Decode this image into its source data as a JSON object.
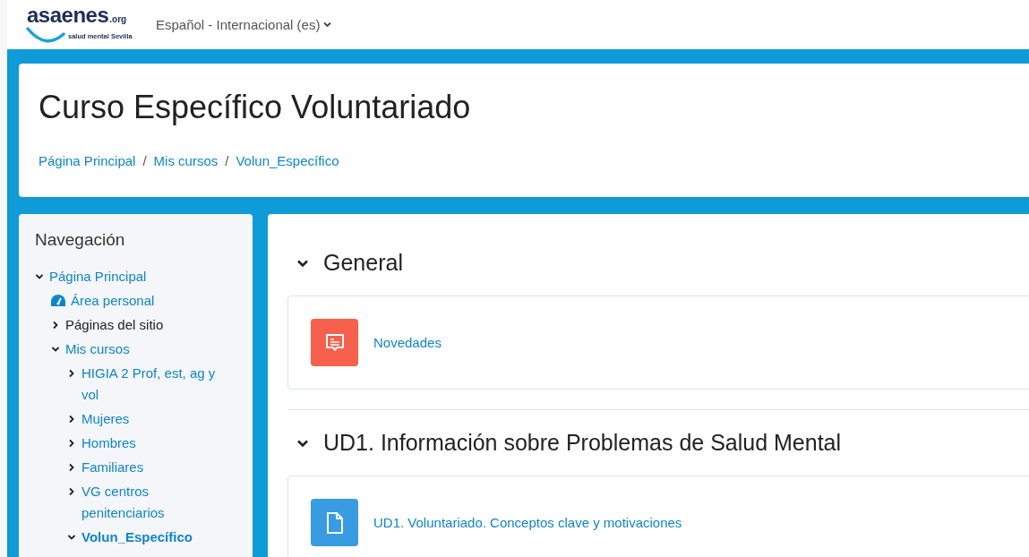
{
  "navbar": {
    "logo": {
      "name": "asaenes",
      "suffix": ".org",
      "tagline": "salud mental Sevilla"
    },
    "language": "Español - Internacional (es)"
  },
  "header": {
    "title": "Curso Específico Voluntariado",
    "breadcrumb": [
      "Página Principal",
      "Mis cursos",
      "Volun_Específico"
    ],
    "separator": "/"
  },
  "sidebar": {
    "title": "Navegación",
    "items": [
      {
        "label": "Página Principal",
        "kind": "branch",
        "expanded": true,
        "link": true,
        "selected": false,
        "children": [
          {
            "label": "Área personal",
            "kind": "dashboard",
            "expanded": false,
            "link": true,
            "selected": false
          },
          {
            "label": "Páginas del sitio",
            "kind": "branch",
            "expanded": false,
            "link": false,
            "selected": false
          },
          {
            "label": "Mis cursos",
            "kind": "branch",
            "expanded": true,
            "link": true,
            "selected": false,
            "children": [
              {
                "label": "HIGIA 2 Prof, est, ag y vol",
                "kind": "branch",
                "expanded": false,
                "link": true,
                "selected": false
              },
              {
                "label": "Mujeres",
                "kind": "branch",
                "expanded": false,
                "link": true,
                "selected": false
              },
              {
                "label": "Hombres",
                "kind": "branch",
                "expanded": false,
                "link": true,
                "selected": false
              },
              {
                "label": "Familiares",
                "kind": "branch",
                "expanded": false,
                "link": true,
                "selected": false
              },
              {
                "label": "VG centros penitenciarios",
                "kind": "branch",
                "expanded": false,
                "link": true,
                "selected": false
              },
              {
                "label": "Volun_Específico",
                "kind": "branch",
                "expanded": true,
                "link": true,
                "selected": true
              }
            ]
          }
        ]
      }
    ]
  },
  "sections": [
    {
      "title": "General",
      "expanded": true,
      "activities": [
        {
          "label": "Novedades",
          "kind": "forum",
          "color": "#f7604d"
        }
      ]
    },
    {
      "title": "UD1. Información sobre Problemas de Salud Mental",
      "expanded": true,
      "activities": [
        {
          "label": "UD1. Voluntariado. Conceptos clave y motivaciones",
          "kind": "page",
          "color": "#399be2"
        }
      ]
    }
  ]
}
